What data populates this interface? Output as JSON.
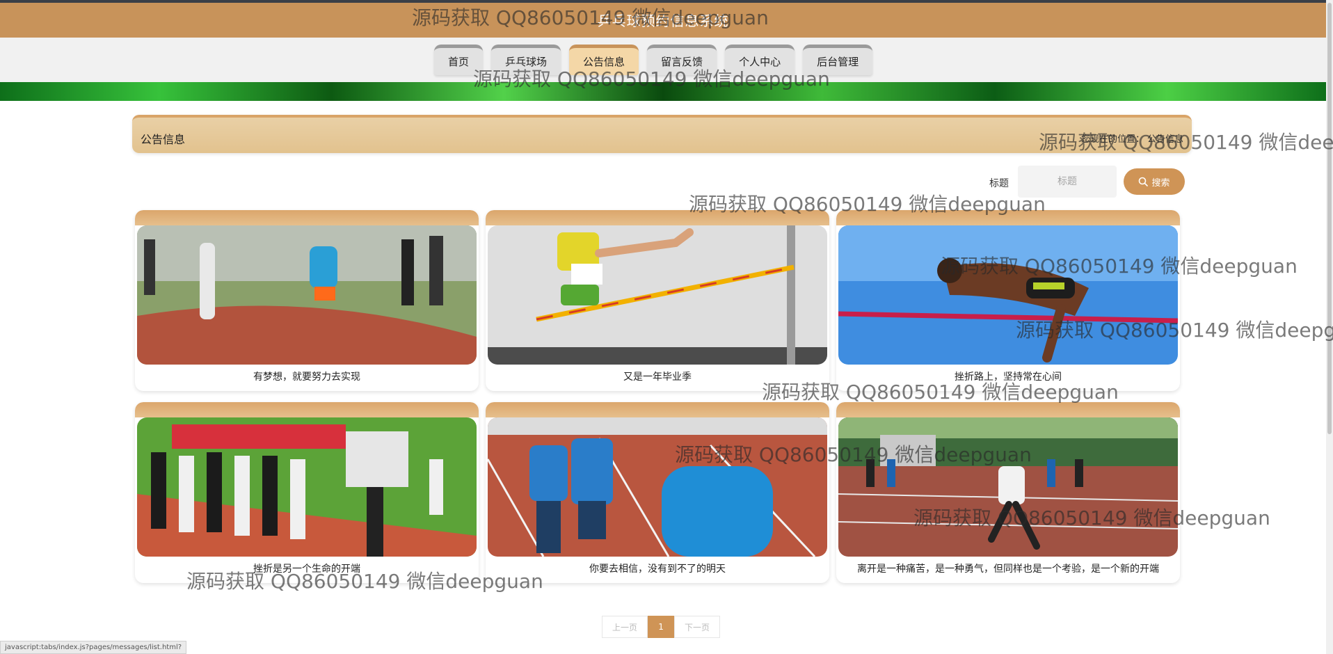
{
  "header": {
    "site_title": "乒乓球预约信息系统"
  },
  "nav": {
    "items": [
      {
        "label": "首页"
      },
      {
        "label": "乒乓球场"
      },
      {
        "label": "公告信息"
      },
      {
        "label": "留言反馈"
      },
      {
        "label": "个人中心"
      },
      {
        "label": "后台管理"
      }
    ],
    "active_index": 2
  },
  "section": {
    "title": "公告信息",
    "breadcrumb_prefix": "您现在的位置：",
    "breadcrumb_current": "公告信息"
  },
  "search": {
    "label": "标题",
    "placeholder": "标题",
    "button_label": "搜索"
  },
  "cards": [
    {
      "title": "有梦想，就要努力去实现",
      "image": "relay-race-photo"
    },
    {
      "title": "又是一年毕业季",
      "image": "high-jump-photo"
    },
    {
      "title": "挫折路上，坚持常在心间",
      "image": "high-jump-sky-photo"
    },
    {
      "title": "挫折是另一个生命的开端",
      "image": "parade-photo"
    },
    {
      "title": "你要去相信，没有到不了的明天",
      "image": "runners-photo"
    },
    {
      "title": "离开是一种痛苦，是一种勇气，但同样也是一个考验，是一个新的开端",
      "image": "sprint-photo"
    }
  ],
  "pagination": {
    "prev_label": "上一页",
    "current_page": "1",
    "next_label": "下一页"
  },
  "statusbar": {
    "text": "javascript:tabs/index.js?pages/messages/list.html?"
  },
  "watermark": {
    "text": "源码获取 QQ86050149 微信deepguan"
  },
  "colors": {
    "brand": "#c8935a",
    "accent": "#cf9456",
    "banner_green": "#2fa83a"
  }
}
